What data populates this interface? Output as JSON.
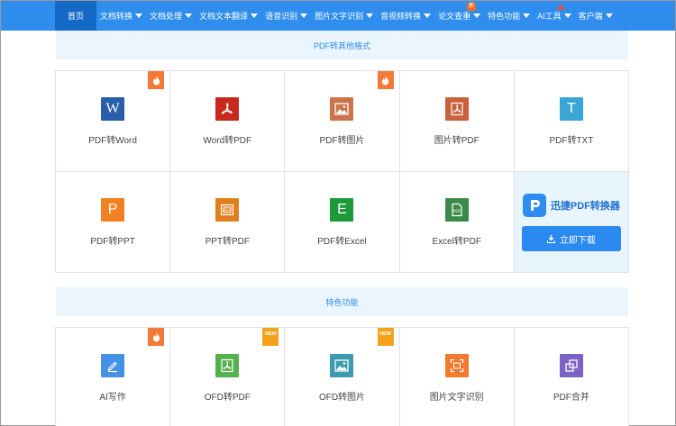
{
  "nav": {
    "home": "首页",
    "items": [
      {
        "label": "文档转换"
      },
      {
        "label": "文档处理"
      },
      {
        "label": "文档文本翻译"
      },
      {
        "label": "语音识别"
      },
      {
        "label": "图片文字识别"
      },
      {
        "label": "音视频转换"
      },
      {
        "label": "论文查重",
        "badge": "新"
      },
      {
        "label": "特色功能"
      },
      {
        "label": "AI工具"
      },
      {
        "label": "客户端"
      }
    ]
  },
  "sections": {
    "pdf_convert": "PDF转其他格式",
    "features": "特色功能"
  },
  "pdf_tools": [
    {
      "label": "PDF转Word",
      "icon": "word-icon",
      "glyph": "W",
      "color": "#2a5dab",
      "corner": "hot"
    },
    {
      "label": "Word转PDF",
      "icon": "pdf-icon",
      "glyph": "",
      "color": "#c8291e"
    },
    {
      "label": "PDF转图片",
      "icon": "image-icon",
      "glyph": "",
      "color": "#c9744b",
      "corner": "hot"
    },
    {
      "label": "图片转PDF",
      "icon": "pdf-icon",
      "glyph": "",
      "color": "#c9613d"
    },
    {
      "label": "PDF转TXT",
      "icon": "text-icon",
      "glyph": "T",
      "color": "#3aa6d6"
    },
    {
      "label": "PDF转PPT",
      "icon": "ppt-icon",
      "glyph": "P",
      "color": "#f08022"
    },
    {
      "label": "PPT转PDF",
      "icon": "ppt-pdf-icon",
      "glyph": "",
      "color": "#e07f1d"
    },
    {
      "label": "PDF转Excel",
      "icon": "excel-icon",
      "glyph": "E",
      "color": "#1e9a3a"
    },
    {
      "label": "Excel转PDF",
      "icon": "excel-pdf-icon",
      "glyph": "",
      "color": "#3c8a4a"
    }
  ],
  "promo": {
    "brand": "迅捷PDF转换器",
    "download": "立即下载"
  },
  "feature_tools": [
    {
      "label": "AI写作",
      "icon": "edit-icon",
      "color": "#4592e4",
      "corner": "hot"
    },
    {
      "label": "OFD转PDF",
      "icon": "ofd-pdf-icon",
      "color": "#55b14d",
      "corner": "new"
    },
    {
      "label": "OFD转图片",
      "icon": "ofd-image-icon",
      "color": "#3c9bb0",
      "corner": "new"
    },
    {
      "label": "图片文字识别",
      "icon": "ocr-icon",
      "color": "#f07a2e"
    },
    {
      "label": "PDF合并",
      "icon": "merge-icon",
      "color": "#7b62c4"
    }
  ],
  "corner_new_text": "NEW"
}
